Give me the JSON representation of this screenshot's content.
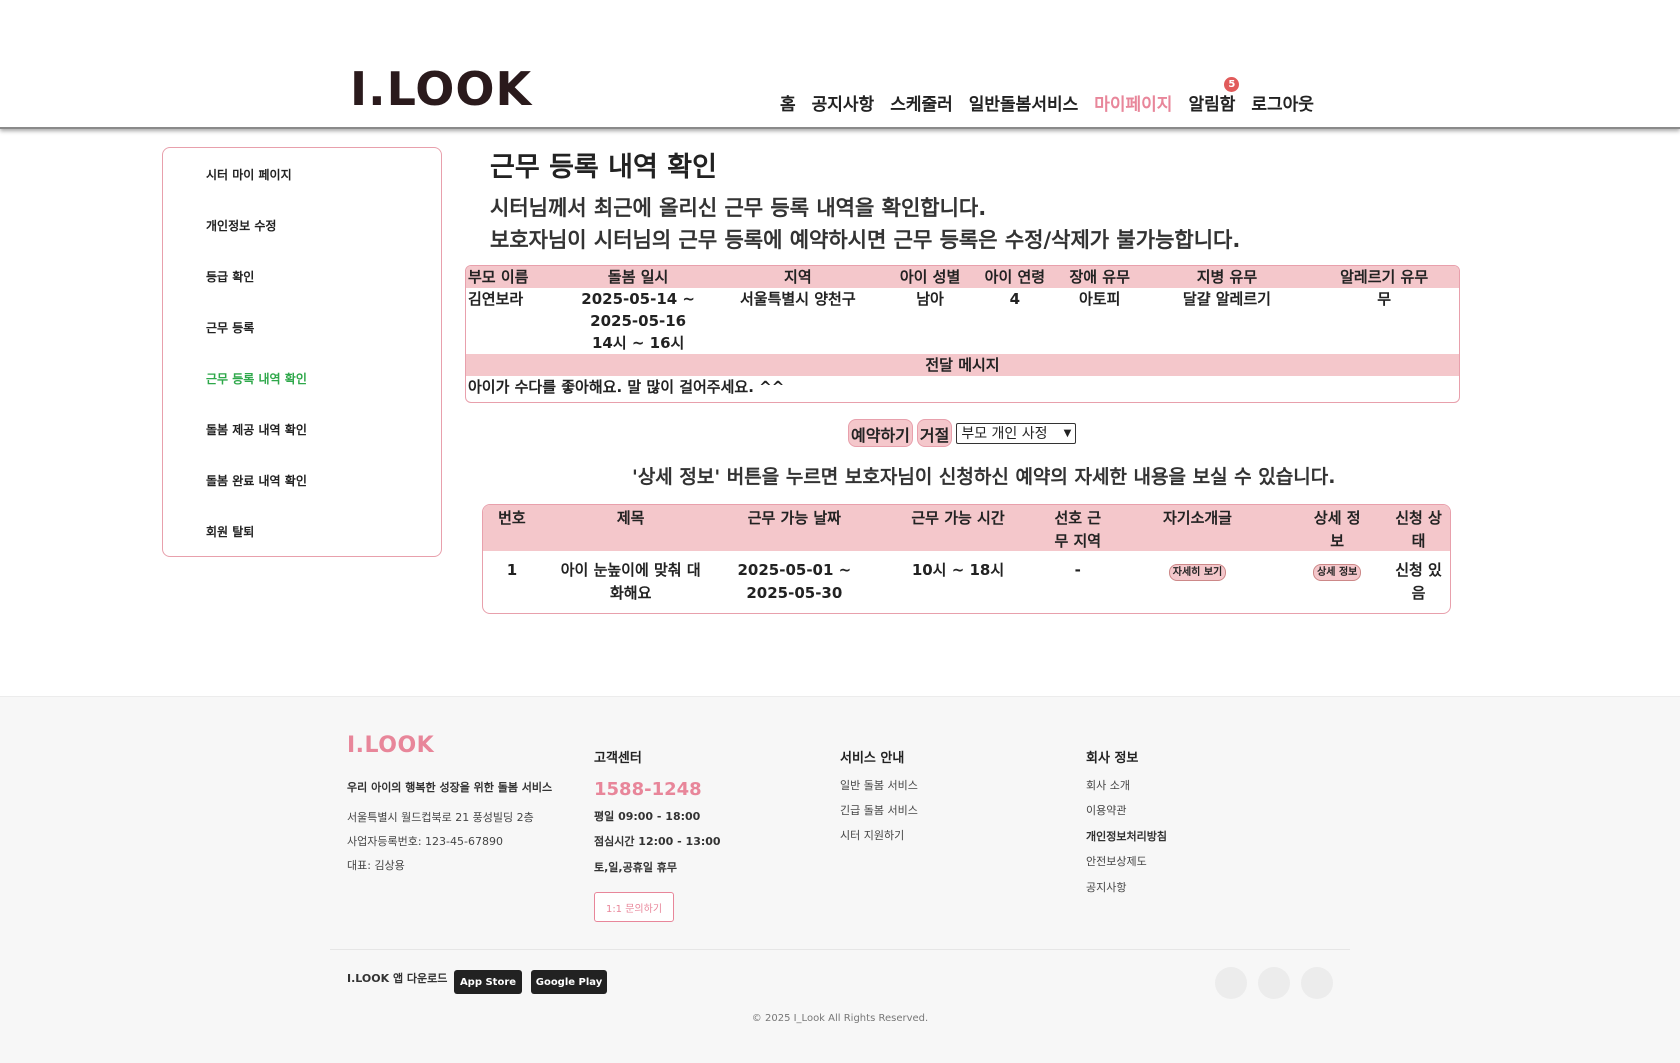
{
  "header": {
    "logo": "I.LOOK",
    "nav": [
      {
        "label": "홈"
      },
      {
        "label": "공지사항"
      },
      {
        "label": "스케줄러"
      },
      {
        "label": "일반돌봄서비스"
      },
      {
        "label": "마이페이지"
      },
      {
        "label": "알림함"
      },
      {
        "label": "로그아웃"
      }
    ],
    "notification_count": "5",
    "accent_color": "#e8869a"
  },
  "sidebar": {
    "items": [
      {
        "label": "시터 마이 페이지"
      },
      {
        "label": "개인정보 수정"
      },
      {
        "label": "등급 확인"
      },
      {
        "label": "근무 등록"
      },
      {
        "label": "근무 등록 내역 확인"
      },
      {
        "label": "돌봄 제공 내역 확인"
      },
      {
        "label": "돌봄 완료 내역 확인"
      },
      {
        "label": "회원 탈퇴"
      }
    ],
    "active_color": "#2ea84a"
  },
  "main": {
    "title": "근무 등록 내역 확인",
    "desc1": "시터님께서 최근에 올리신 근무 등록 내역을 확인합니다.",
    "desc2": "보호자님이 시터님의 근무 등록에 예약하시면 근무 등록은 수정/삭제가 불가능합니다.",
    "detail": {
      "headers": [
        "부모 이름",
        "돌봄 일시",
        "지역",
        "아이 성별",
        "아이 연령",
        "장애 유무",
        "지병 유무",
        "알레르기 유무"
      ],
      "row": {
        "parent": "김연보라",
        "date_from": "2025-05-14 ~",
        "date_to": "2025-05-16",
        "time": "14시 ~ 16시",
        "region": "서울특별시 양천구",
        "gender": "남아",
        "age": "4",
        "disability": "아토피",
        "illness": "달걀 알레르기",
        "allergy": "무"
      },
      "message_header": "전달 메시지",
      "message": "아이가 수다를 좋아해요. 말 많이 걸어주세요. ^^"
    },
    "actions": {
      "reserve": "예약하기",
      "reject": "거절",
      "reason_selected": "부모 개인 사정"
    },
    "hint": "'상세 정보' 버튼을 누르면 보호자님이 신청하신 예약의 자세한 내용을 보실 수 있습니다.",
    "list": {
      "headers": {
        "no": "번호",
        "title": "제목",
        "dates": "근무 가능 날짜",
        "time": "근무 가능 시간",
        "region_1": "선호 근",
        "region_2": "무 지역",
        "intro": "자기소개글",
        "detail_1": "상세 정",
        "detail_2": "보",
        "status_1": "신청 상",
        "status_2": "태"
      },
      "rows": [
        {
          "no": "1",
          "title_1": "아이 눈높이에 맞춰 대",
          "title_2": "화해요",
          "date_from": "2025-05-01 ~",
          "date_to": "2025-05-30",
          "time": "10시 ~ 18시",
          "region": "-",
          "intro_btn": "자세히 보기",
          "detail_btn": "상세 정보",
          "status_1": "신청 있",
          "status_2": "음"
        }
      ]
    }
  },
  "footer": {
    "logo": "I.LOOK",
    "tagline": "우리 아이의 행복한 성장을 위한 돌봄 서비스",
    "address": "서울특별시 월드컵북로 21 풍성빌딩 2층",
    "biz_no": "사업자등록번호: 123-45-67890",
    "ceo": "대표: 김상용",
    "cs_title": "고객센터",
    "phone": "1588-1248",
    "hours1": "평일 09:00 - 18:00",
    "hours2": "점심시간 12:00 - 13:00",
    "hours3": "토,일,공휴일 휴무",
    "inquiry": "1:1 문의하기",
    "service_title": "서비스 안내",
    "services": [
      "일반 돌봄 서비스",
      "긴급 돌봄 서비스",
      "시터 지원하기"
    ],
    "company_title": "회사 정보",
    "company": [
      "회사 소개",
      "이용약관",
      "개인정보처리방침",
      "안전보상제도",
      "공지사항"
    ],
    "app_download": "I.LOOK 앱 다운로드",
    "app_store": "App Store",
    "google_play": "Google Play",
    "copyright": "© 2025 I_Look All Rights Reserved."
  }
}
